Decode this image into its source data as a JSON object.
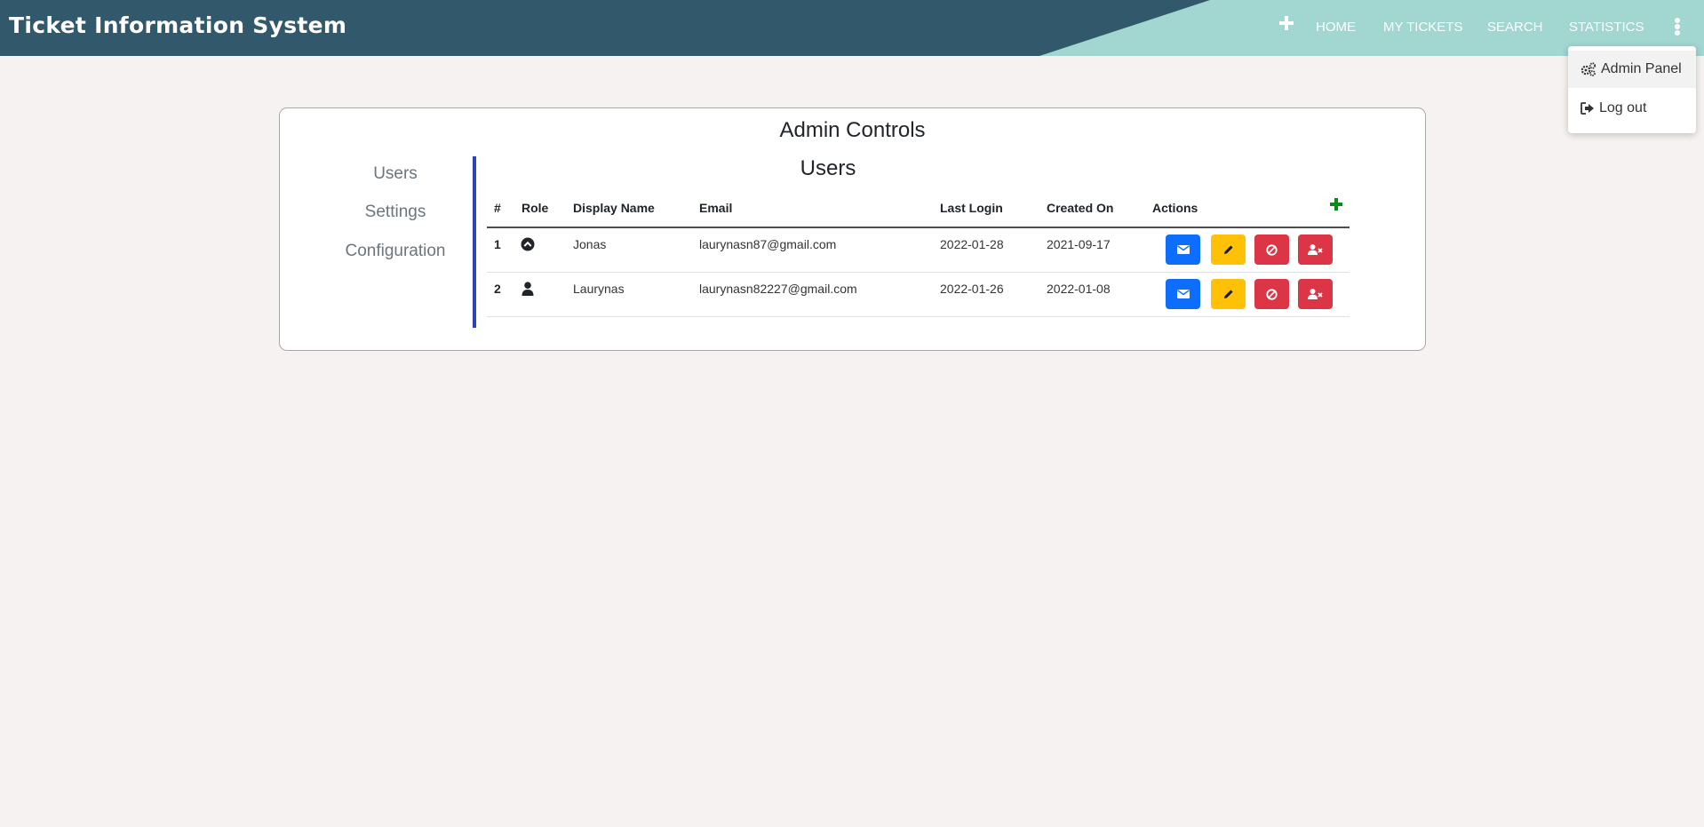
{
  "app": {
    "title": "Ticket Information System"
  },
  "nav": {
    "links": [
      "HOME",
      "MY TICKETS",
      "SEARCH",
      "STATISTICS"
    ],
    "add_icon": "plus-icon",
    "menu_icon": "vertical-dots-icon"
  },
  "dropdown": {
    "items": [
      {
        "label": "Admin Panel",
        "icon": "gears-icon"
      },
      {
        "label": "Log out",
        "icon": "sign-out-icon"
      }
    ]
  },
  "card": {
    "title": "Admin Controls",
    "side_nav": [
      "Users",
      "Settings",
      "Configuration"
    ],
    "section_title": "Users"
  },
  "users_table": {
    "columns": [
      "#",
      "Role",
      "Display Name",
      "Email",
      "Last Login",
      "Created On",
      "Actions"
    ],
    "rows": [
      {
        "num": "1",
        "role_icon": "admin-chevron-circle-icon",
        "name": "Jonas",
        "email": "laurynasn87@gmail.com",
        "last_login": "2022-01-28",
        "created_on": "2021-09-17"
      },
      {
        "num": "2",
        "role_icon": "user-icon",
        "name": "Laurynas",
        "email": "laurynasn82227@gmail.com",
        "last_login": "2022-01-26",
        "created_on": "2022-01-08"
      }
    ],
    "actions": [
      {
        "icon": "envelope-icon",
        "color": "#0d6efd"
      },
      {
        "icon": "pencil-icon",
        "color": "#ffc107"
      },
      {
        "icon": "ban-icon",
        "color": "#dc3545"
      },
      {
        "icon": "user-remove-icon",
        "color": "#dc3545"
      }
    ]
  },
  "colors": {
    "navbar": "#31586b",
    "navbar_accent": "#a1d6d1",
    "side_divider": "#3340b8",
    "add_user": "#0a8a1a",
    "background": "#f6f2f1"
  }
}
